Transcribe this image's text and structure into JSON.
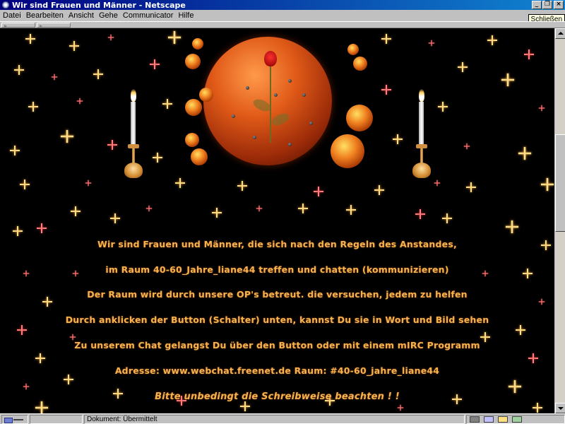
{
  "window": {
    "title": "Wir sind Frauen und Männer - Netscape",
    "buttons": {
      "minimize": "_",
      "restore": "❐",
      "close": "×"
    }
  },
  "tooltip": "Schließen",
  "menu": [
    {
      "label": "Datei"
    },
    {
      "label": "Bearbeiten"
    },
    {
      "label": "Ansicht"
    },
    {
      "label": "Gehe"
    },
    {
      "label": "Communicator"
    },
    {
      "label": "Hilfe"
    }
  ],
  "page": {
    "lines": [
      "Wir sind Frauen und Männer, die sich nach den Regeln des Anstandes,",
      "im Raum 40-60_Jahre_liane44  treffen und chatten (kommunizieren)",
      "Der Raum wird durch unsere OP's betreut. die versuchen, jedem zu helfen",
      "Durch anklicken der Button (Schalter) unten, kannst Du sie in Wort und Bild sehen",
      "Zu unserem Chat gelangst Du über den Button oder mit einem mIRC Programm",
      "Adresse:  www.webchat.freenet.de    Raum: #40-60_jahre_liane44",
      "Bitte unbedingt die Schreibweise beachten ! !"
    ],
    "text_color": "#f6b24e",
    "background_color": "#000000"
  },
  "status": {
    "text": "Dokument: Übermittelt"
  }
}
